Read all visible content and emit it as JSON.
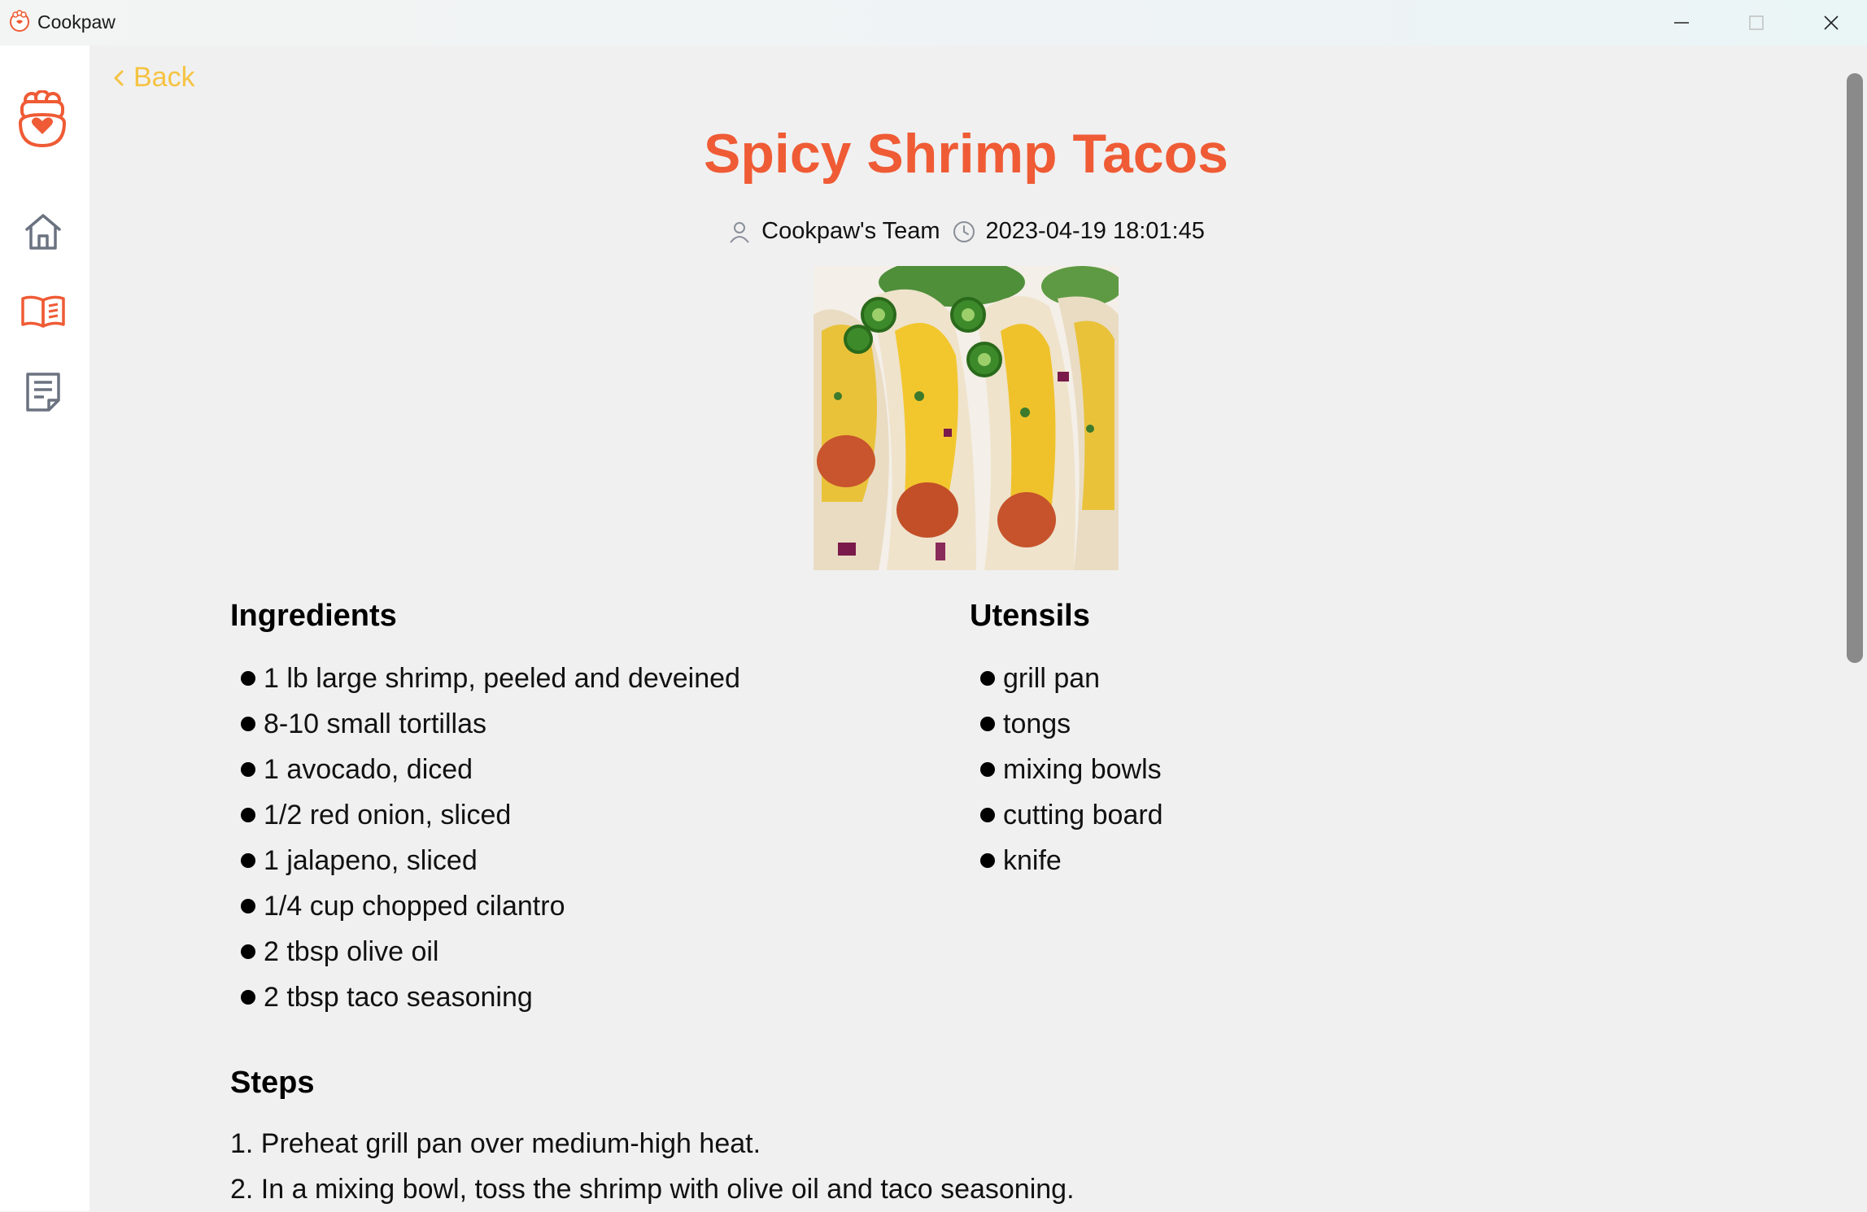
{
  "window": {
    "title": "Cookpaw",
    "controls": [
      "minimize",
      "maximize",
      "close"
    ]
  },
  "sidebar": {
    "logo_icon": "paw-chef-logo",
    "items": [
      {
        "icon": "home-icon"
      },
      {
        "icon": "book-icon"
      },
      {
        "icon": "notes-icon"
      }
    ]
  },
  "nav": {
    "back_label": "Back"
  },
  "recipe": {
    "title": "Spicy Shrimp Tacos",
    "author": "Cookpaw's Team",
    "timestamp": "2023-04-19 18:01:45",
    "image_alt": "shrimp tacos with mango salsa and jalapeno",
    "ingredients_heading": "Ingredients",
    "ingredients": [
      "1 lb large shrimp, peeled and deveined",
      "8-10 small tortillas",
      "1 avocado, diced",
      "1/2 red onion, sliced",
      "1 jalapeno, sliced",
      "1/4 cup chopped cilantro",
      "2 tbsp olive oil",
      "2 tbsp taco seasoning"
    ],
    "utensils_heading": "Utensils",
    "utensils": [
      "grill pan",
      "tongs",
      "mixing bowls",
      "cutting board",
      "knife"
    ],
    "steps_heading": "Steps",
    "steps": [
      "1. Preheat grill pan over medium-high heat.",
      "2. In a mixing bowl, toss the shrimp with olive oil and taco seasoning."
    ]
  },
  "colors": {
    "accent": "#ef5b35",
    "back_link": "#f5c342",
    "sidebar_icon_gray": "#6b7280",
    "sidebar_icon_active": "#ef5b35"
  }
}
